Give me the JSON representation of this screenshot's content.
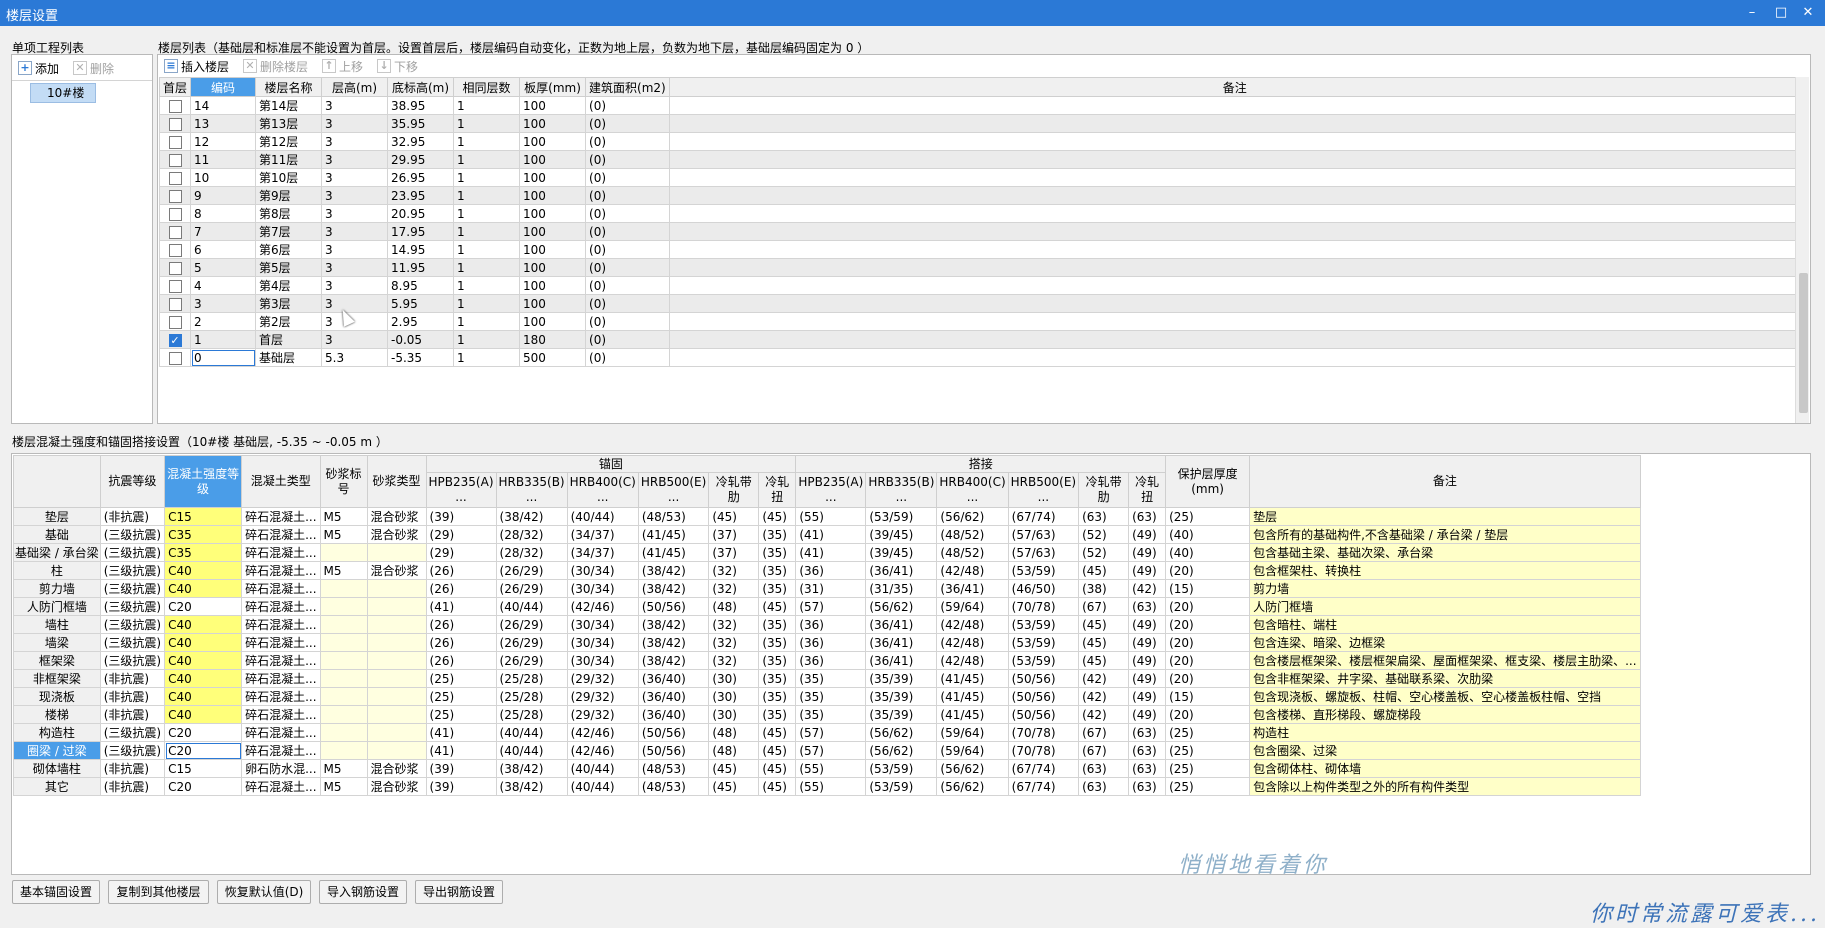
{
  "window": {
    "title": "楼层设置",
    "min": "–",
    "max": "□",
    "close": "✕"
  },
  "projects": {
    "title": "单项工程列表",
    "add": "添加",
    "delete": "删除",
    "items": [
      "10#楼"
    ]
  },
  "floors": {
    "title": "楼层列表（基础层和标准层不能设置为首层。设置首层后，楼层编码自动变化，正数为地上层，负数为地下层，基础层编码固定为 0 ）",
    "toolbar": {
      "insert": "插入楼层",
      "delete": "删除楼层",
      "up": "上移",
      "down": "下移"
    },
    "columns": [
      "首层",
      "编码",
      "楼层名称",
      "层高(m)",
      "底标高(m)",
      "相同层数",
      "板厚(mm)",
      "建筑面积(m2)",
      "备注"
    ],
    "rows": [
      {
        "first": false,
        "code": "14",
        "name": "第14层",
        "h": "3",
        "elev": "38.95",
        "same": "1",
        "slab": "100",
        "area": "(0)"
      },
      {
        "first": false,
        "code": "13",
        "name": "第13层",
        "h": "3",
        "elev": "35.95",
        "same": "1",
        "slab": "100",
        "area": "(0)"
      },
      {
        "first": false,
        "code": "12",
        "name": "第12层",
        "h": "3",
        "elev": "32.95",
        "same": "1",
        "slab": "100",
        "area": "(0)"
      },
      {
        "first": false,
        "code": "11",
        "name": "第11层",
        "h": "3",
        "elev": "29.95",
        "same": "1",
        "slab": "100",
        "area": "(0)"
      },
      {
        "first": false,
        "code": "10",
        "name": "第10层",
        "h": "3",
        "elev": "26.95",
        "same": "1",
        "slab": "100",
        "area": "(0)"
      },
      {
        "first": false,
        "code": "9",
        "name": "第9层",
        "h": "3",
        "elev": "23.95",
        "same": "1",
        "slab": "100",
        "area": "(0)"
      },
      {
        "first": false,
        "code": "8",
        "name": "第8层",
        "h": "3",
        "elev": "20.95",
        "same": "1",
        "slab": "100",
        "area": "(0)"
      },
      {
        "first": false,
        "code": "7",
        "name": "第7层",
        "h": "3",
        "elev": "17.95",
        "same": "1",
        "slab": "100",
        "area": "(0)"
      },
      {
        "first": false,
        "code": "6",
        "name": "第6层",
        "h": "3",
        "elev": "14.95",
        "same": "1",
        "slab": "100",
        "area": "(0)"
      },
      {
        "first": false,
        "code": "5",
        "name": "第5层",
        "h": "3",
        "elev": "11.95",
        "same": "1",
        "slab": "100",
        "area": "(0)"
      },
      {
        "first": false,
        "code": "4",
        "name": "第4层",
        "h": "3",
        "elev": "8.95",
        "same": "1",
        "slab": "100",
        "area": "(0)"
      },
      {
        "first": false,
        "code": "3",
        "name": "第3层",
        "h": "3",
        "elev": "5.95",
        "same": "1",
        "slab": "100",
        "area": "(0)"
      },
      {
        "first": false,
        "code": "2",
        "name": "第2层",
        "h": "3",
        "elev": "2.95",
        "same": "1",
        "slab": "100",
        "area": "(0)"
      },
      {
        "first": true,
        "code": "1",
        "name": "首层",
        "h": "3",
        "elev": "-0.05",
        "same": "1",
        "slab": "180",
        "area": "(0)"
      },
      {
        "first": false,
        "code": "0",
        "name": "基础层",
        "h": "5.3",
        "elev": "-5.35",
        "same": "1",
        "slab": "500",
        "area": "(0)"
      }
    ]
  },
  "concrete": {
    "title": "楼层混凝土强度和锚固搭接设置（10#楼  基础层, -5.35 ~ -0.05 m ）",
    "groups": {
      "anchor": "锚固",
      "lap": "搭接"
    },
    "columns": [
      "抗震等级",
      "混凝土强度等级",
      "混凝土类型",
      "砂浆标号",
      "砂浆类型",
      "HPB235(A)\n...",
      "HRB335(B)\n...",
      "HRB400(C)\n...",
      "HRB500(E)\n...",
      "冷轧带肋",
      "冷轧扭",
      "HPB235(A)\n...",
      "HRB335(B)\n...",
      "HRB400(C)\n...",
      "HRB500(E)\n...",
      "冷轧带肋",
      "冷轧扭",
      "保护层厚度(mm)",
      "备注"
    ],
    "rows": [
      {
        "n": "垫层",
        "v": [
          "(非抗震)",
          "C15",
          "碎石混凝土...",
          "M5",
          "混合砂浆",
          "(39)",
          "(38/42)",
          "(40/44)",
          "(48/53)",
          "(45)",
          "(45)",
          "(55)",
          "(53/59)",
          "(56/62)",
          "(67/74)",
          "(63)",
          "(63)",
          "(25)",
          "垫层"
        ]
      },
      {
        "n": "基础",
        "v": [
          "(三级抗震)",
          "C35",
          "碎石混凝土...",
          "M5",
          "混合砂浆",
          "(29)",
          "(28/32)",
          "(34/37)",
          "(41/45)",
          "(37)",
          "(35)",
          "(41)",
          "(39/45)",
          "(48/52)",
          "(57/63)",
          "(52)",
          "(49)",
          "(40)",
          "包含所有的基础构件,不含基础梁 / 承台梁 / 垫层"
        ]
      },
      {
        "n": "基础梁 / 承台梁",
        "v": [
          "(三级抗震)",
          "C35",
          "碎石混凝土...",
          "",
          "",
          "(29)",
          "(28/32)",
          "(34/37)",
          "(41/45)",
          "(37)",
          "(35)",
          "(41)",
          "(39/45)",
          "(48/52)",
          "(57/63)",
          "(52)",
          "(49)",
          "(40)",
          "包含基础主梁、基础次梁、承台梁"
        ]
      },
      {
        "n": "柱",
        "v": [
          "(三级抗震)",
          "C40",
          "碎石混凝土...",
          "M5",
          "混合砂浆",
          "(26)",
          "(26/29)",
          "(30/34)",
          "(38/42)",
          "(32)",
          "(35)",
          "(36)",
          "(36/41)",
          "(42/48)",
          "(53/59)",
          "(45)",
          "(49)",
          "(20)",
          "包含框架柱、转换柱"
        ]
      },
      {
        "n": "剪力墙",
        "v": [
          "(三级抗震)",
          "C40",
          "碎石混凝土...",
          "",
          "",
          "(26)",
          "(26/29)",
          "(30/34)",
          "(38/42)",
          "(32)",
          "(35)",
          "(31)",
          "(31/35)",
          "(36/41)",
          "(46/50)",
          "(38)",
          "(42)",
          "(15)",
          "剪力墙"
        ]
      },
      {
        "n": "人防门框墙",
        "v": [
          "(三级抗震)",
          "C20",
          "碎石混凝土...",
          "",
          "",
          "(41)",
          "(40/44)",
          "(42/46)",
          "(50/56)",
          "(48)",
          "(45)",
          "(57)",
          "(56/62)",
          "(59/64)",
          "(70/78)",
          "(67)",
          "(63)",
          "(20)",
          "人防门框墙"
        ]
      },
      {
        "n": "墙柱",
        "v": [
          "(三级抗震)",
          "C40",
          "碎石混凝土...",
          "",
          "",
          "(26)",
          "(26/29)",
          "(30/34)",
          "(38/42)",
          "(32)",
          "(35)",
          "(36)",
          "(36/41)",
          "(42/48)",
          "(53/59)",
          "(45)",
          "(49)",
          "(20)",
          "包含暗柱、端柱"
        ]
      },
      {
        "n": "墙梁",
        "v": [
          "(三级抗震)",
          "C40",
          "碎石混凝土...",
          "",
          "",
          "(26)",
          "(26/29)",
          "(30/34)",
          "(38/42)",
          "(32)",
          "(35)",
          "(36)",
          "(36/41)",
          "(42/48)",
          "(53/59)",
          "(45)",
          "(49)",
          "(20)",
          "包含连梁、暗梁、边框梁"
        ]
      },
      {
        "n": "框架梁",
        "v": [
          "(三级抗震)",
          "C40",
          "碎石混凝土...",
          "",
          "",
          "(26)",
          "(26/29)",
          "(30/34)",
          "(38/42)",
          "(32)",
          "(35)",
          "(36)",
          "(36/41)",
          "(42/48)",
          "(53/59)",
          "(45)",
          "(49)",
          "(20)",
          "包含楼层框架梁、楼层框架扁梁、屋面框架梁、框支梁、楼层主肋梁、..."
        ]
      },
      {
        "n": "非框架梁",
        "v": [
          "(非抗震)",
          "C40",
          "碎石混凝土...",
          "",
          "",
          "(25)",
          "(25/28)",
          "(29/32)",
          "(36/40)",
          "(30)",
          "(35)",
          "(35)",
          "(35/39)",
          "(41/45)",
          "(50/56)",
          "(42)",
          "(49)",
          "(20)",
          "包含非框架梁、井字梁、基础联系梁、次肋梁"
        ]
      },
      {
        "n": "现浇板",
        "v": [
          "(非抗震)",
          "C40",
          "碎石混凝土...",
          "",
          "",
          "(25)",
          "(25/28)",
          "(29/32)",
          "(36/40)",
          "(30)",
          "(35)",
          "(35)",
          "(35/39)",
          "(41/45)",
          "(50/56)",
          "(42)",
          "(49)",
          "(15)",
          "包含现浇板、螺旋板、柱帽、空心楼盖板、空心楼盖板柱帽、空挡"
        ]
      },
      {
        "n": "楼梯",
        "v": [
          "(非抗震)",
          "C40",
          "碎石混凝土...",
          "",
          "",
          "(25)",
          "(25/28)",
          "(29/32)",
          "(36/40)",
          "(30)",
          "(35)",
          "(35)",
          "(35/39)",
          "(41/45)",
          "(50/56)",
          "(42)",
          "(49)",
          "(20)",
          "包含楼梯、直形梯段、螺旋梯段"
        ]
      },
      {
        "n": "构造柱",
        "v": [
          "(三级抗震)",
          "C20",
          "碎石混凝土...",
          "",
          "",
          "(41)",
          "(40/44)",
          "(42/46)",
          "(50/56)",
          "(48)",
          "(45)",
          "(57)",
          "(56/62)",
          "(59/64)",
          "(70/78)",
          "(67)",
          "(63)",
          "(25)",
          "构造柱"
        ]
      },
      {
        "n": "圈梁 / 过梁",
        "v": [
          "(三级抗震)",
          "C20",
          "碎石混凝土...",
          "",
          "",
          "(41)",
          "(40/44)",
          "(42/46)",
          "(50/56)",
          "(48)",
          "(45)",
          "(57)",
          "(56/62)",
          "(59/64)",
          "(70/78)",
          "(67)",
          "(63)",
          "(25)",
          "包含圈梁、过梁"
        ]
      },
      {
        "n": "砌体墙柱",
        "v": [
          "(非抗震)",
          "C15",
          "卵石防水混...",
          "M5",
          "混合砂浆",
          "(39)",
          "(38/42)",
          "(40/44)",
          "(48/53)",
          "(45)",
          "(45)",
          "(55)",
          "(53/59)",
          "(56/62)",
          "(67/74)",
          "(63)",
          "(63)",
          "(25)",
          "包含砌体柱、砌体墙"
        ]
      },
      {
        "n": "其它",
        "v": [
          "(非抗震)",
          "C20",
          "碎石混凝土...",
          "M5",
          "混合砂浆",
          "(39)",
          "(38/42)",
          "(40/44)",
          "(48/53)",
          "(45)",
          "(45)",
          "(55)",
          "(53/59)",
          "(56/62)",
          "(67/74)",
          "(63)",
          "(63)",
          "(25)",
          "包含除以上构件类型之外的所有构件类型"
        ]
      }
    ]
  },
  "buttons": [
    "基本锚固设置",
    "复制到其他楼层",
    "恢复默认值(D)",
    "导入钢筋设置",
    "导出钢筋设置"
  ],
  "watermarks": [
    "悄悄地看着你",
    "你时常流露可爱表..."
  ],
  "icons": {
    "add": "plus-icon",
    "delete": "delete-icon",
    "insert": "insert-icon",
    "up": "arrow-up-icon",
    "down": "arrow-down-icon"
  }
}
